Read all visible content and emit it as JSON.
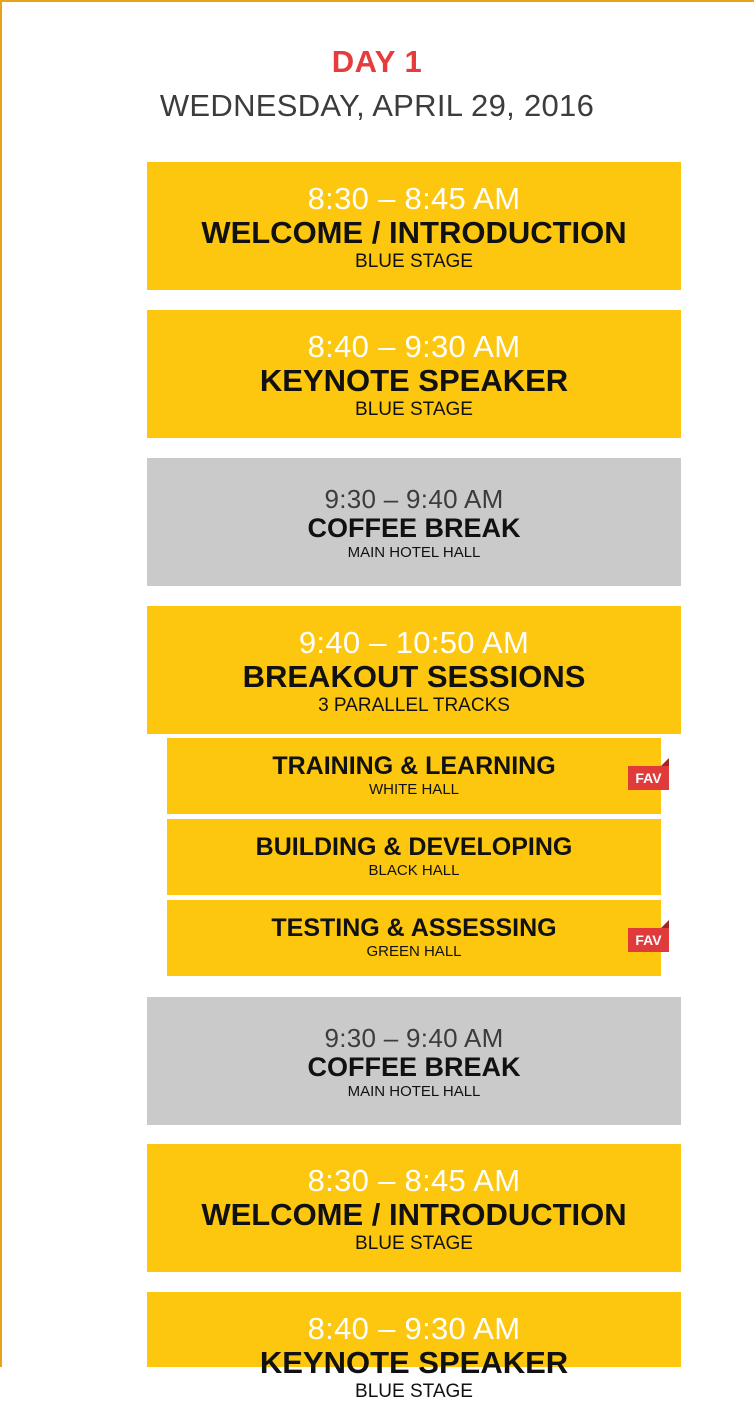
{
  "header": {
    "day": "DAY 1",
    "date": "WEDNESDAY, APRIL 29, 2016"
  },
  "sessions": [
    {
      "time": "8:30 – 8:45 AM",
      "title": "WELCOME / INTRODUCTION",
      "place": "BLUE STAGE"
    },
    {
      "time": "8:40 – 9:30 AM",
      "title": "KEYNOTE SPEAKER",
      "place": "BLUE STAGE"
    },
    {
      "time": "9:30 – 9:40 AM",
      "title": "COFFEE BREAK",
      "place": "MAIN HOTEL HALL"
    },
    {
      "time": "9:40 – 10:50 AM",
      "title": "BREAKOUT SESSIONS",
      "place": "3 PARALLEL TRACKS"
    },
    {
      "time": "9:30 – 9:40 AM",
      "title": "COFFEE BREAK",
      "place": "MAIN HOTEL HALL"
    },
    {
      "time": "8:30 – 8:45 AM",
      "title": "WELCOME / INTRODUCTION",
      "place": "BLUE STAGE"
    },
    {
      "time": "8:40 – 9:30 AM",
      "title": "KEYNOTE SPEAKER",
      "place": "BLUE STAGE"
    }
  ],
  "tracks": [
    {
      "title": "TRAINING & LEARNING",
      "place": "WHITE HALL",
      "badge": "FAV"
    },
    {
      "title": "BUILDING & DEVELOPING",
      "place": "BLACK HALL",
      "badge": ""
    },
    {
      "title": "TESTING & ASSESSING",
      "place": "GREEN HALL",
      "badge": "FAV"
    }
  ],
  "colors": {
    "accent_yellow": "#fcc70e",
    "break_gray": "#cacaca",
    "day_red": "#e63c3c",
    "fav_red": "#e03a3a"
  }
}
